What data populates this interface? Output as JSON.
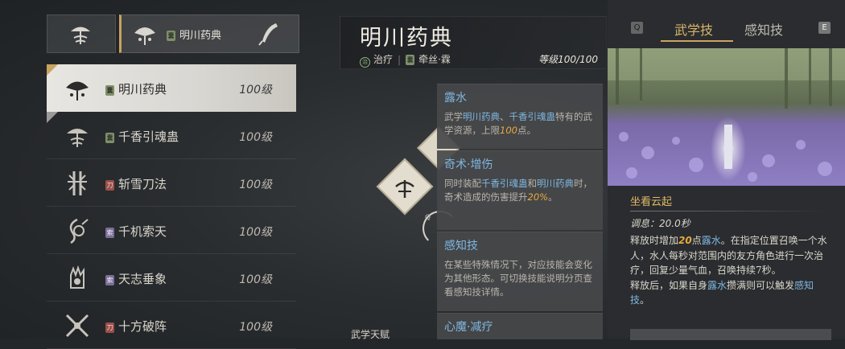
{
  "left": {
    "slots": {
      "selected_label": "明川药典",
      "selected_badge": "囊"
    },
    "skills": [
      {
        "name": "明川药典",
        "level": "100级",
        "badge": "囊"
      },
      {
        "name": "千香引魂蛊",
        "level": "100级",
        "badge": "囊"
      },
      {
        "name": "斩雪刀法",
        "level": "100级",
        "badge": "刀"
      },
      {
        "name": "千机索天",
        "level": "100级",
        "badge": "索"
      },
      {
        "name": "天志垂象",
        "level": "100级",
        "badge": "索"
      },
      {
        "name": "十方破阵",
        "level": "100级",
        "badge": "刀"
      }
    ]
  },
  "middle": {
    "title": "明川药典",
    "role_icon": "治",
    "role": "治疗",
    "weapon_badge": "囊",
    "weapon": "牵丝·霖",
    "level": "等级100/100",
    "q_key": "Q",
    "talent_label": "武学天赋",
    "tips": [
      {
        "title": "露水",
        "desc": [
          "武学",
          "明川药典",
          "、",
          "千香引魂蛊",
          "特有的武学资源，上限",
          "100",
          "点。"
        ]
      },
      {
        "title": "奇术·增伤",
        "desc": [
          "同时装配",
          "千香引魂蛊",
          "和",
          "明川药典",
          "时，奇术造成的伤害提升",
          "20%",
          "。"
        ]
      },
      {
        "title": "感知技",
        "desc": [
          "在某些特殊情况下，对应技能会变化为其他形态。可切换技能说明分页查看感知技详情。"
        ]
      },
      {
        "title": "心魔·减疗"
      }
    ]
  },
  "right": {
    "key_q": "Q",
    "key_e": "E",
    "tab_active": "武学技",
    "tab_other": "感知技",
    "skill_title": "坐看云起",
    "cooldown": "调息：20.0秒",
    "desc": [
      "释放时增加",
      "20",
      "点",
      "露水",
      "。在指定位置召唤一个水人，水人每秒对范围内的友方角色进行一次治疗，回复少量气血，召唤持续7秒。",
      "释放后，如果自身",
      "露水",
      "攒满则可以触发",
      "感知技",
      "。"
    ]
  },
  "colors": {
    "accent_gold": "#c9a461",
    "link_blue": "#7fb7e0",
    "highlight_orange": "#e7a93c"
  }
}
